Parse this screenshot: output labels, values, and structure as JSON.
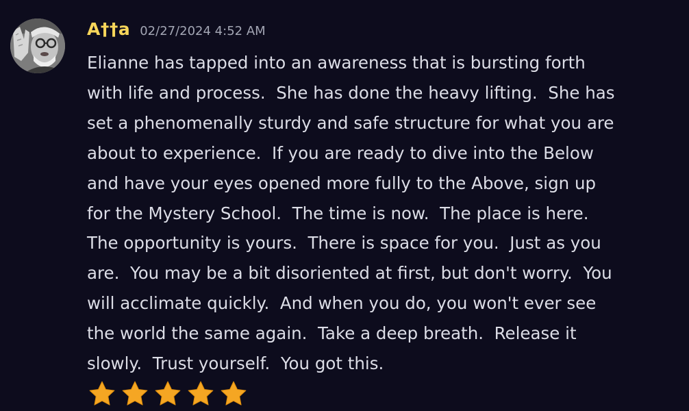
{
  "message": {
    "author": "A††a",
    "timestamp": "02/27/2024 4:52 AM",
    "lines": [
      "Elianne has tapped into an awareness that is bursting forth",
      "with life and process.  She has done the heavy lifting.  She has",
      "set a phenomenally sturdy and safe structure for what you are",
      "about to experience.  If you are ready to dive into the Below",
      "and have your eyes opened more fully to the Above, sign up",
      "for the Mystery School.  The time is now.  The place is here.",
      "The opportunity is yours.  There is space for you.  Just as you",
      "are.  You may be a bit disoriented at first, but don't worry.  You",
      "will acclimate quickly.  And when you do, you won't ever see",
      "the world the same again.  Take a deep breath.  Release it",
      "slowly.  Trust yourself.  You got this."
    ],
    "rating": {
      "value": 5,
      "max": 5,
      "icon": "star-emoji",
      "color": "#f5a623"
    }
  },
  "colors": {
    "background": "#0d0c1d",
    "username": "#f7d65a",
    "timestamp": "#a3a6b4",
    "text": "#dcdde6"
  }
}
